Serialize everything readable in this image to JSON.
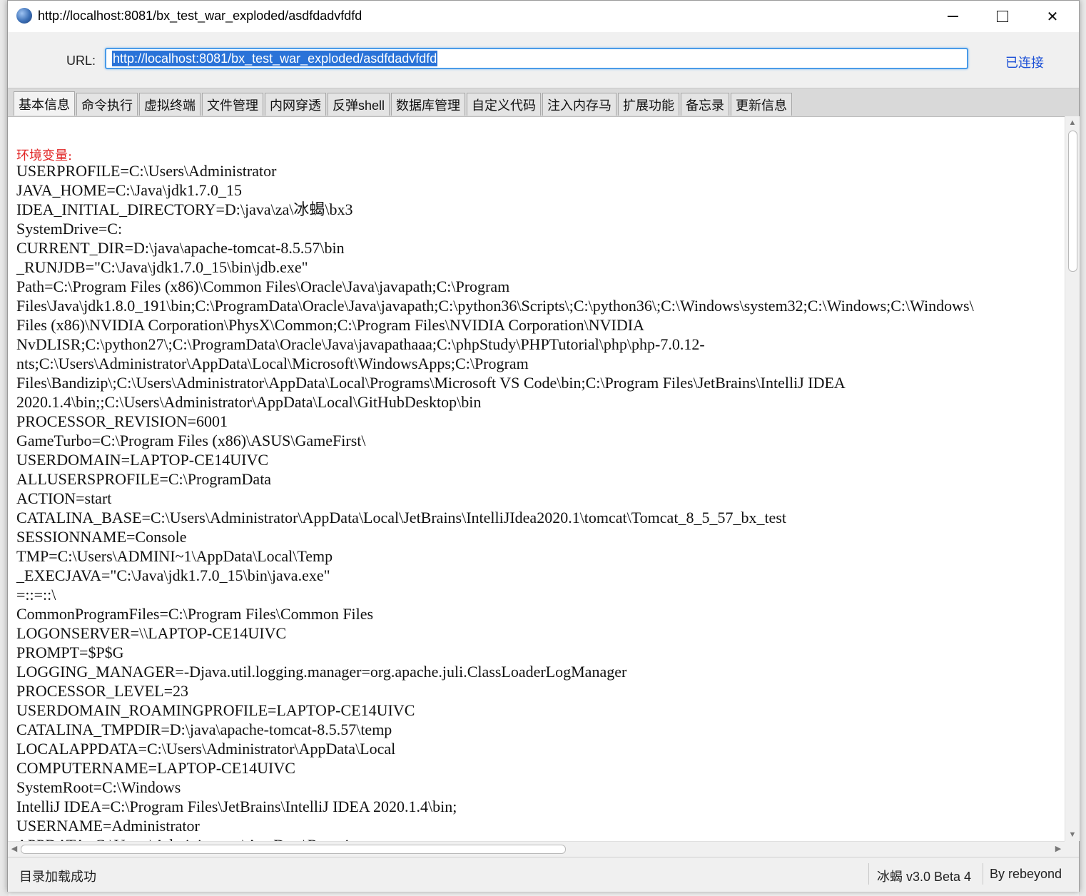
{
  "window": {
    "title": "http://localhost:8081/bx_test_war_exploded/asdfdadvfdfd"
  },
  "url_bar": {
    "label": "URL:",
    "value": "http://localhost:8081/bx_test_war_exploded/asdfdadvfdfd",
    "status": "已连接"
  },
  "tabs": [
    {
      "label": "基本信息",
      "active": true
    },
    {
      "label": "命令执行"
    },
    {
      "label": "虚拟终端"
    },
    {
      "label": "文件管理"
    },
    {
      "label": "内网穿透"
    },
    {
      "label": "反弹shell"
    },
    {
      "label": "数据库管理"
    },
    {
      "label": "自定义代码"
    },
    {
      "label": "注入内存马"
    },
    {
      "label": "扩展功能"
    },
    {
      "label": "备忘录"
    },
    {
      "label": "更新信息"
    }
  ],
  "content": {
    "section_header": "环境变量:",
    "lines": [
      "USERPROFILE=C:\\Users\\Administrator",
      "JAVA_HOME=C:\\Java\\jdk1.7.0_15",
      "IDEA_INITIAL_DIRECTORY=D:\\java\\za\\冰蝎\\bx3",
      "SystemDrive=C:",
      "CURRENT_DIR=D:\\java\\apache-tomcat-8.5.57\\bin",
      "_RUNJDB=\"C:\\Java\\jdk1.7.0_15\\bin\\jdb.exe\"",
      "Path=C:\\Program Files (x86)\\Common Files\\Oracle\\Java\\javapath;C:\\Program",
      "Files\\Java\\jdk1.8.0_191\\bin;C:\\ProgramData\\Oracle\\Java\\javapath;C:\\python36\\Scripts\\;C:\\python36\\;C:\\Windows\\system32;C:\\Windows;C:\\Windows\\",
      "Files (x86)\\NVIDIA Corporation\\PhysX\\Common;C:\\Program Files\\NVIDIA Corporation\\NVIDIA",
      "NvDLISR;C:\\python27\\;C:\\ProgramData\\Oracle\\Java\\javapathaaa;C:\\phpStudy\\PHPTutorial\\php\\php-7.0.12-",
      "nts;C:\\Users\\Administrator\\AppData\\Local\\Microsoft\\WindowsApps;C:\\Program",
      "Files\\Bandizip\\;C:\\Users\\Administrator\\AppData\\Local\\Programs\\Microsoft VS Code\\bin;C:\\Program Files\\JetBrains\\IntelliJ IDEA",
      "2020.1.4\\bin;;C:\\Users\\Administrator\\AppData\\Local\\GitHubDesktop\\bin",
      "PROCESSOR_REVISION=6001",
      "GameTurbo=C:\\Program Files (x86)\\ASUS\\GameFirst\\",
      "USERDOMAIN=LAPTOP-CE14UIVC",
      "ALLUSERSPROFILE=C:\\ProgramData",
      "ACTION=start",
      "CATALINA_BASE=C:\\Users\\Administrator\\AppData\\Local\\JetBrains\\IntelliJIdea2020.1\\tomcat\\Tomcat_8_5_57_bx_test",
      "SESSIONNAME=Console",
      "TMP=C:\\Users\\ADMINI~1\\AppData\\Local\\Temp",
      "_EXECJAVA=\"C:\\Java\\jdk1.7.0_15\\bin\\java.exe\"",
      "=::=::\\",
      "CommonProgramFiles=C:\\Program Files\\Common Files",
      "LOGONSERVER=\\\\LAPTOP-CE14UIVC",
      "PROMPT=$P$G",
      "LOGGING_MANAGER=-Djava.util.logging.manager=org.apache.juli.ClassLoaderLogManager",
      "PROCESSOR_LEVEL=23",
      "USERDOMAIN_ROAMINGPROFILE=LAPTOP-CE14UIVC",
      "CATALINA_TMPDIR=D:\\java\\apache-tomcat-8.5.57\\temp",
      "LOCALAPPDATA=C:\\Users\\Administrator\\AppData\\Local",
      "COMPUTERNAME=LAPTOP-CE14UIVC",
      "SystemRoot=C:\\Windows",
      "IntelliJ IDEA=C:\\Program Files\\JetBrains\\IntelliJ IDEA 2020.1.4\\bin;",
      "USERNAME=Administrator",
      "APPDATA=C:\\Users\\Administrator\\AppData\\Roaming"
    ]
  },
  "status_bar": {
    "message": "目录加载成功",
    "version": "冰蝎 v3.0 Beta 4",
    "author": "By rebeyond"
  },
  "icons": {
    "app": "app-logo-icon",
    "minimize": "minimize-icon",
    "maximize": "maximize-icon",
    "close": "close-icon"
  }
}
